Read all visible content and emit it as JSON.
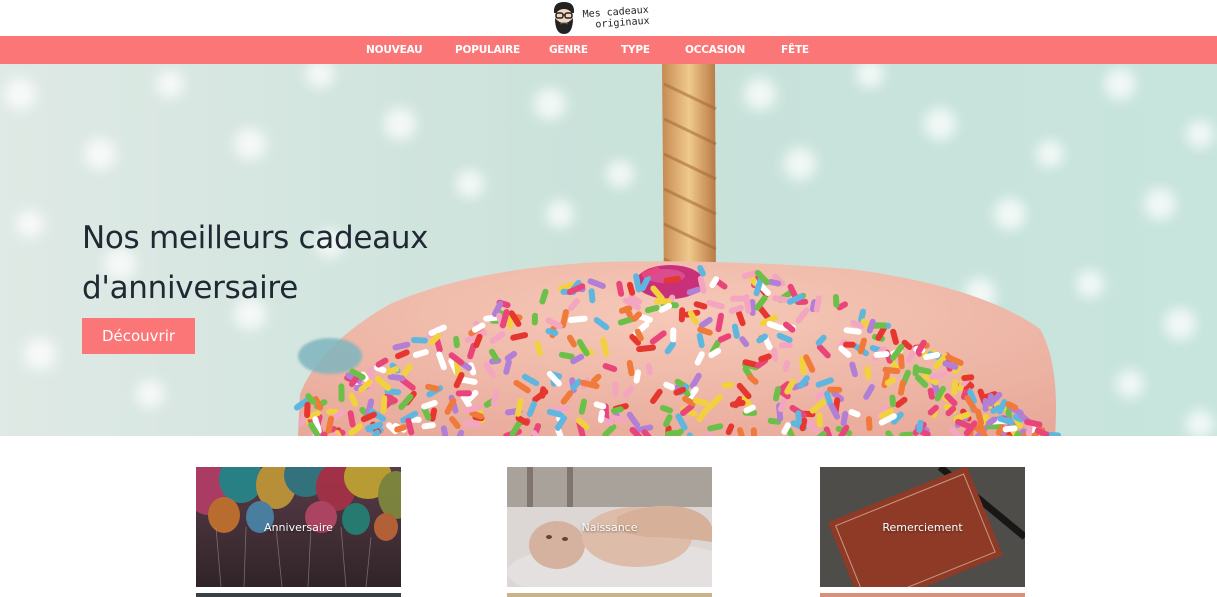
{
  "logo": {
    "line1": "Mes cadeaux",
    "line2": "originaux",
    "icon": "bearded-man-with-glasses-logo"
  },
  "nav": {
    "items": [
      {
        "label": "NOUVEAU"
      },
      {
        "label": "POPULAIRE"
      },
      {
        "label": "GENRE"
      },
      {
        "label": "TYPE"
      },
      {
        "label": "OCCASION"
      },
      {
        "label": "FÊTE"
      }
    ]
  },
  "hero": {
    "title_line1": "Nos meilleurs cadeaux",
    "title_line2": "d'anniversaire",
    "button_label": "Découvrir"
  },
  "categories": [
    {
      "label": "Anniversaire"
    },
    {
      "label": "Naissance"
    },
    {
      "label": "Remerciement"
    }
  ],
  "colors": {
    "accent": "#fb7676",
    "hero_text": "#1f2833",
    "hero_background": "#cfe3dc"
  }
}
